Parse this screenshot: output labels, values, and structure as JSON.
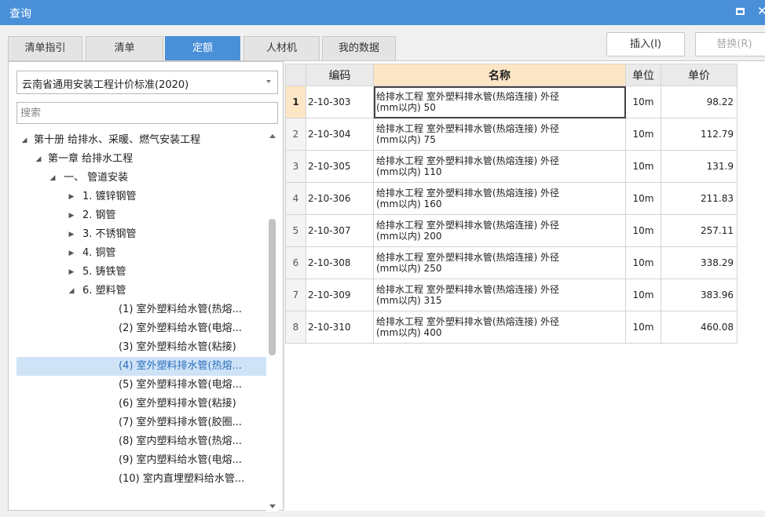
{
  "window": {
    "title": "查询"
  },
  "tabs": [
    {
      "label": "清单指引"
    },
    {
      "label": "清单"
    },
    {
      "label": "定额"
    },
    {
      "label": "人材机"
    },
    {
      "label": "我的数据"
    }
  ],
  "actions": {
    "insert": "插入(I)",
    "replace": "替换(R)"
  },
  "standard_select": {
    "value": "云南省通用安装工程计价标准(2020)"
  },
  "search": {
    "placeholder": "搜索"
  },
  "tree": [
    {
      "label": "第十册 给排水、采暖、燃气安装工程",
      "toggle": "◢"
    },
    {
      "label": "第一章 给排水工程",
      "toggle": "◢"
    },
    {
      "label": "一、 管道安装",
      "toggle": "◢"
    },
    {
      "label": "1. 镀锌钢管",
      "toggle": "▶"
    },
    {
      "label": "2. 钢管",
      "toggle": "▶"
    },
    {
      "label": "3. 不锈钢管",
      "toggle": "▶"
    },
    {
      "label": "4. 铜管",
      "toggle": "▶"
    },
    {
      "label": "5. 铸铁管",
      "toggle": "▶"
    },
    {
      "label": "6. 塑料管",
      "toggle": "◢"
    },
    {
      "label": "(1) 室外塑料给水管(热熔...",
      "toggle": ""
    },
    {
      "label": "(2) 室外塑料给水管(电熔...",
      "toggle": ""
    },
    {
      "label": "(3) 室外塑料给水管(粘接)",
      "toggle": ""
    },
    {
      "label": "(4) 室外塑料排水管(热熔...",
      "toggle": ""
    },
    {
      "label": "(5) 室外塑料排水管(电熔...",
      "toggle": ""
    },
    {
      "label": "(6) 室外塑料排水管(粘接)",
      "toggle": ""
    },
    {
      "label": "(7) 室外塑料排水管(胶圈...",
      "toggle": ""
    },
    {
      "label": "(8) 室内塑料给水管(热熔...",
      "toggle": ""
    },
    {
      "label": "(9) 室内塑料给水管(电熔...",
      "toggle": ""
    },
    {
      "label": "(10) 室内直埋塑料给水管...",
      "toggle": ""
    }
  ],
  "grid": {
    "headers": {
      "code": "编码",
      "name": "名称",
      "unit": "单位",
      "price": "单价"
    },
    "rows": [
      {
        "idx": "1",
        "code": "2-10-303",
        "name1": "给排水工程 室外塑料排水管(热熔连接) 外径",
        "name2": "(mm以内) 50",
        "unit": "10m",
        "price": "98.22"
      },
      {
        "idx": "2",
        "code": "2-10-304",
        "name1": "给排水工程 室外塑料排水管(热熔连接) 外径",
        "name2": "(mm以内) 75",
        "unit": "10m",
        "price": "112.79"
      },
      {
        "idx": "3",
        "code": "2-10-305",
        "name1": "给排水工程 室外塑料排水管(热熔连接) 外径",
        "name2": "(mm以内) 110",
        "unit": "10m",
        "price": "131.9"
      },
      {
        "idx": "4",
        "code": "2-10-306",
        "name1": "给排水工程 室外塑料排水管(热熔连接) 外径",
        "name2": "(mm以内) 160",
        "unit": "10m",
        "price": "211.83"
      },
      {
        "idx": "5",
        "code": "2-10-307",
        "name1": "给排水工程 室外塑料排水管(热熔连接) 外径",
        "name2": "(mm以内) 200",
        "unit": "10m",
        "price": "257.11"
      },
      {
        "idx": "6",
        "code": "2-10-308",
        "name1": "给排水工程 室外塑料排水管(热熔连接) 外径",
        "name2": "(mm以内) 250",
        "unit": "10m",
        "price": "338.29"
      },
      {
        "idx": "7",
        "code": "2-10-309",
        "name1": "给排水工程 室外塑料排水管(热熔连接) 外径",
        "name2": "(mm以内) 315",
        "unit": "10m",
        "price": "383.96"
      },
      {
        "idx": "8",
        "code": "2-10-310",
        "name1": "给排水工程 室外塑料排水管(热熔连接) 外径",
        "name2": "(mm以内) 400",
        "unit": "10m",
        "price": "460.08"
      }
    ]
  },
  "colors": {
    "accent": "#4a90d9",
    "selected_row": "#cfe3f7",
    "header_highlight": "#fde6c6"
  }
}
